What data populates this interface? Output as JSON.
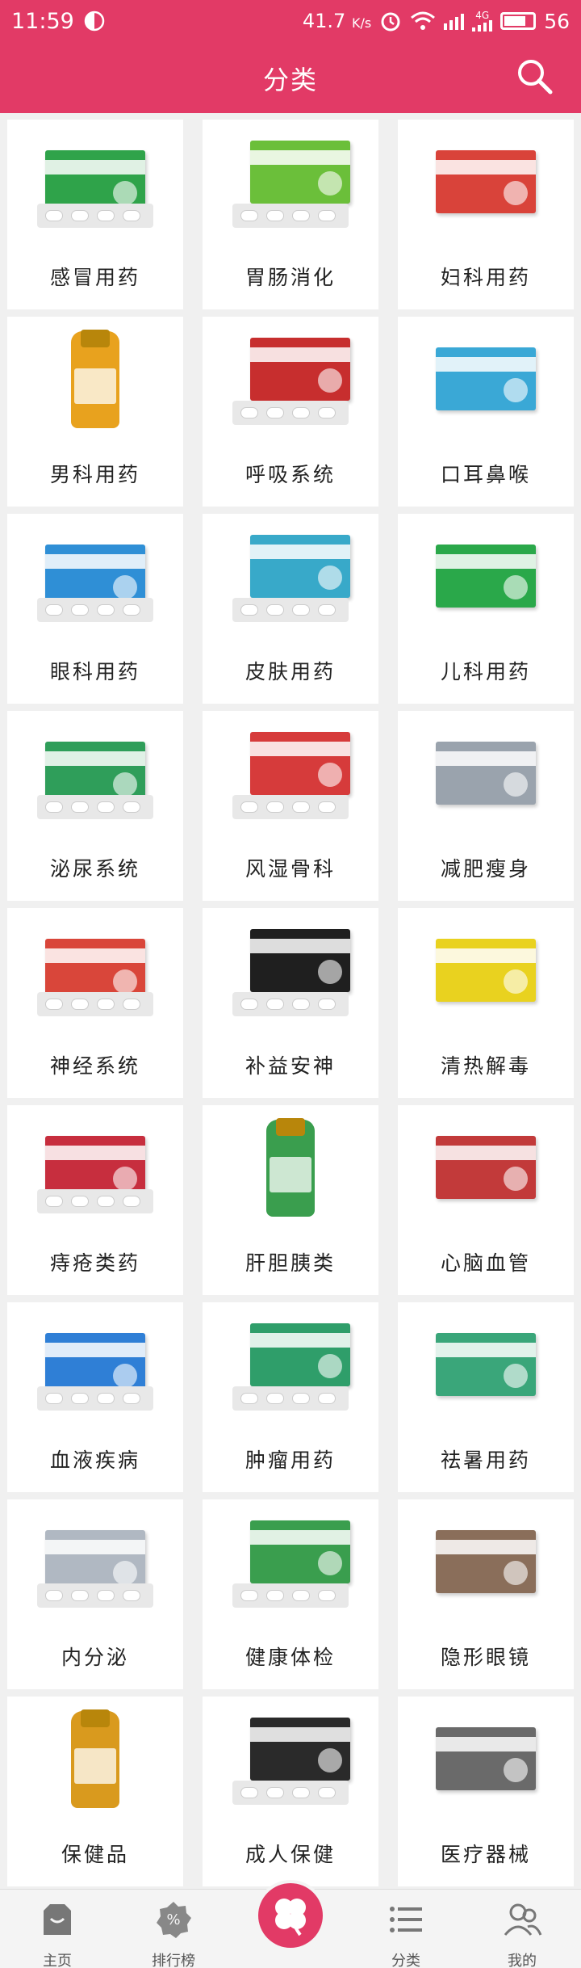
{
  "status_bar": {
    "time": "11:59",
    "speed": "41.7",
    "speed_unit": "K/s",
    "network": "4G",
    "battery": "56"
  },
  "header": {
    "title": "分类",
    "search_icon": "search-icon"
  },
  "categories": [
    {
      "label": "感冒用药",
      "box_color": "#2fa34a"
    },
    {
      "label": "胃肠消化",
      "box_color": "#6bbf3a"
    },
    {
      "label": "妇科用药",
      "box_color": "#d9433a"
    },
    {
      "label": "男科用药",
      "box_color": "#e8a21e"
    },
    {
      "label": "呼吸系统",
      "box_color": "#c72e2e"
    },
    {
      "label": "口耳鼻喉",
      "box_color": "#3aa8d6"
    },
    {
      "label": "眼科用药",
      "box_color": "#2f8fd6"
    },
    {
      "label": "皮肤用药",
      "box_color": "#38a9c9"
    },
    {
      "label": "儿科用药",
      "box_color": "#2aa84a"
    },
    {
      "label": "泌尿系统",
      "box_color": "#2f9e5a"
    },
    {
      "label": "风湿骨科",
      "box_color": "#d63b3b"
    },
    {
      "label": "减肥瘦身",
      "box_color": "#9aa3ad"
    },
    {
      "label": "神经系统",
      "box_color": "#d9463a"
    },
    {
      "label": "补益安神",
      "box_color": "#1f1f1f"
    },
    {
      "label": "清热解毒",
      "box_color": "#e9d21f"
    },
    {
      "label": "痔疮类药",
      "box_color": "#c72e3e"
    },
    {
      "label": "肝胆胰类",
      "box_color": "#3a9e4e"
    },
    {
      "label": "心脑血管",
      "box_color": "#c23a3a"
    },
    {
      "label": "血液疾病",
      "box_color": "#2f7fd6"
    },
    {
      "label": "肿瘤用药",
      "box_color": "#2f9e6a"
    },
    {
      "label": "祛暑用药",
      "box_color": "#3aa67a"
    },
    {
      "label": "内分泌",
      "box_color": "#b0b8c2"
    },
    {
      "label": "健康体检",
      "box_color": "#3a9e4e"
    },
    {
      "label": "隐形眼镜",
      "box_color": "#8a6e5a"
    },
    {
      "label": "保健品",
      "box_color": "#d99a1e"
    },
    {
      "label": "成人保健",
      "box_color": "#2a2a2a"
    },
    {
      "label": "医疗器械",
      "box_color": "#6a6a6a"
    }
  ],
  "tabbar": {
    "home": "主页",
    "ranking": "排行榜",
    "category": "分类",
    "mine": "我的",
    "center_icon": "clover-icon"
  },
  "colors": {
    "brand": "#e23a66",
    "background": "#f0f0f0",
    "card": "#ffffff",
    "text": "#222222"
  }
}
